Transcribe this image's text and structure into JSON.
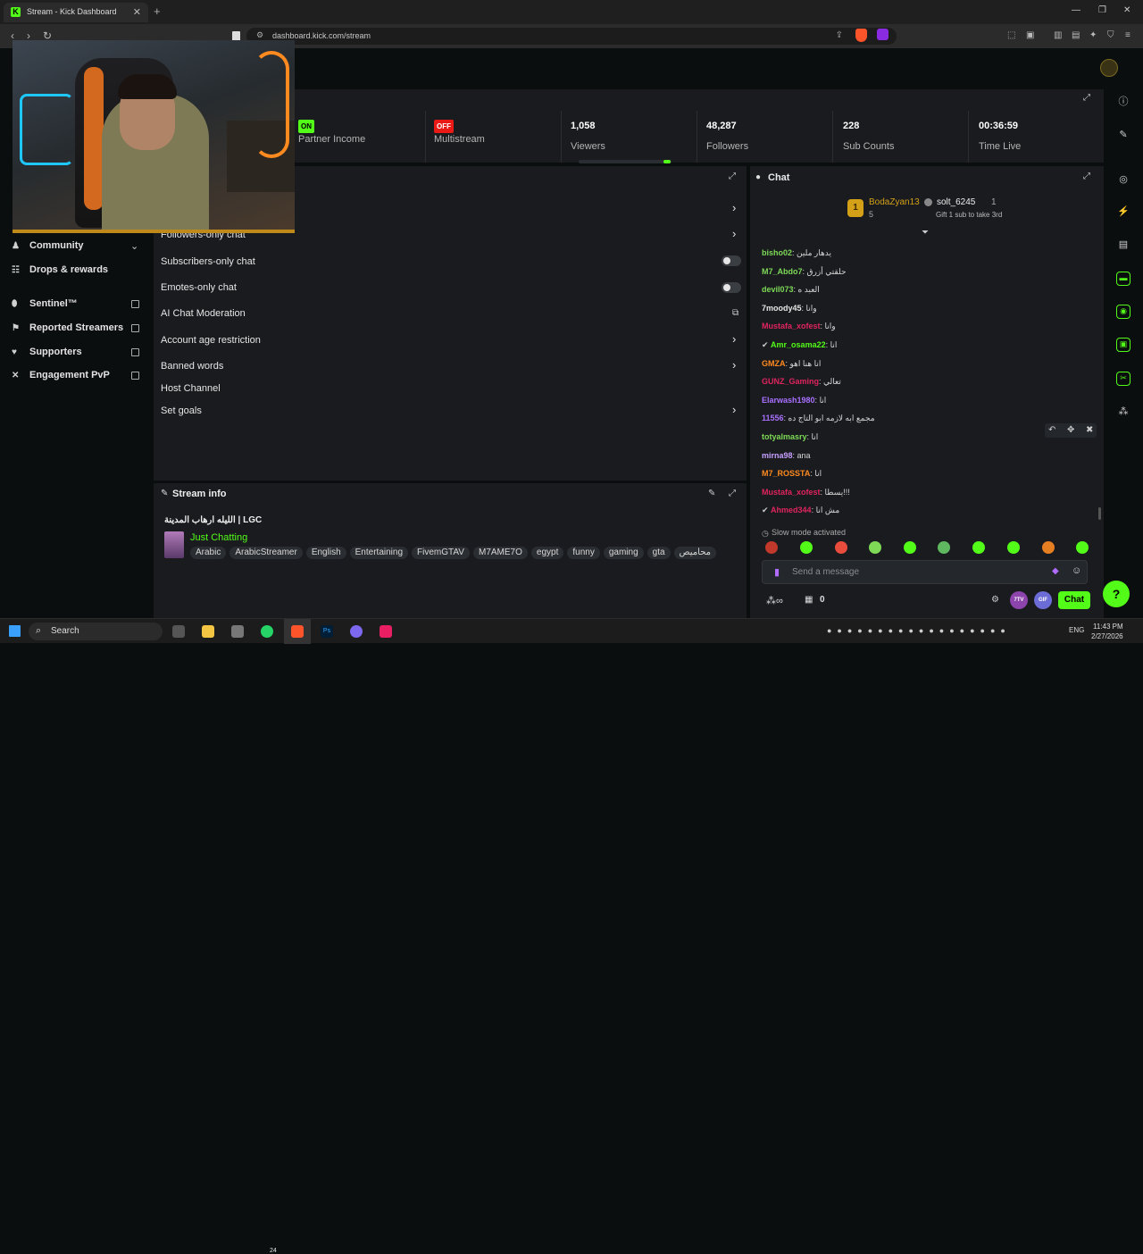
{
  "browser": {
    "tab_title": "Stream - Kick Dashboard",
    "tab_favicon": "K",
    "url": "dashboard.kick.com/stream"
  },
  "nav": {
    "items": [
      {
        "label": "Community",
        "icon": "users-icon"
      },
      {
        "label": "Drops & rewards",
        "icon": "gift-icon"
      },
      {
        "label": "Sentinel™",
        "icon": "shield-icon"
      },
      {
        "label": "Reported Streamers",
        "icon": "flag-icon"
      },
      {
        "label": "Supporters",
        "icon": "heart-icon"
      },
      {
        "label": "Engagement PvP",
        "icon": "swords-icon"
      }
    ]
  },
  "stats": {
    "partner_income": {
      "status": "ON",
      "label": "Partner Income"
    },
    "multistream": {
      "status": "OFF",
      "label": "Multistream"
    },
    "viewers": {
      "value": "1,058",
      "label": "Viewers"
    },
    "followers": {
      "value": "48,287",
      "label": "Followers"
    },
    "subs": {
      "value": "228",
      "label": "Sub Counts"
    },
    "time_live": {
      "value": "00:36:59",
      "label": "Time Live"
    }
  },
  "mod": {
    "rows": [
      {
        "label": "Followers-only chat"
      },
      {
        "label": "Subscribers-only chat"
      },
      {
        "label": "Emotes-only chat"
      },
      {
        "label": "AI Chat Moderation"
      },
      {
        "label": "Account age restriction"
      },
      {
        "label": "Banned words"
      },
      {
        "label": "Host Channel"
      },
      {
        "label": "Set goals"
      }
    ]
  },
  "stream_info": {
    "header": "Stream info",
    "title": "الليله ارهاب المدينة | LGC",
    "category": "Just Chatting",
    "tags": [
      "Arabic",
      "ArabicStreamer",
      "English",
      "Entertaining",
      "FivemGTAV",
      "M7AME7O",
      "egypt",
      "funny",
      "gaming",
      "gta",
      "محاميص"
    ]
  },
  "chat": {
    "header": "Chat",
    "leader1": {
      "name": "BodaZyan13",
      "rank": "1",
      "count": "5"
    },
    "leader2": {
      "name": "solt_6245",
      "count": "1",
      "sub": "Gift 1 sub to take 3rd"
    },
    "messages": [
      {
        "user": "bisho02",
        "text": "يدهار ملين",
        "color": "#7ed957"
      },
      {
        "user": "M7_Abdo7",
        "text": "حلقتي أزرق",
        "color": "#7ed957"
      },
      {
        "user": "devil073",
        "text": "العبد ه",
        "color": "#7ed957"
      },
      {
        "user": "7moody45",
        "text": "وانا",
        "color": "#e6e6e6"
      },
      {
        "user": "Mustafa_xofest",
        "text": "وانا",
        "color": "#e0245e"
      },
      {
        "user": "Amr_osama22",
        "text": "انا",
        "color": "#53fc18"
      },
      {
        "user": "GMZA",
        "text": "انا هنا اهو",
        "color": "#ff8a1f"
      },
      {
        "user": "GUNZ_Gaming",
        "text": "تعالي",
        "color": "#e0245e"
      },
      {
        "user": "Elarwash1980",
        "text": "انا",
        "color": "#a970ff"
      },
      {
        "user": "11556",
        "text": "مجمع ابه لازمه ابو التاج ده",
        "color": "#a970ff"
      },
      {
        "user": "totyalmasry",
        "text": "انا",
        "color": "#7ed957"
      },
      {
        "user": "mirna98",
        "text": "ana",
        "color": "#c7a0ff"
      },
      {
        "user": "M7_ROSSTA",
        "text": "انا",
        "color": "#ff8a1f"
      },
      {
        "user": "Mustafa_xofest",
        "text": "يسطا!!!",
        "color": "#e0245e"
      },
      {
        "user": "Ahmed344",
        "text": "مش انا",
        "color": "#e0245e"
      }
    ],
    "slow_mode": "Slow mode activated",
    "placeholder": "Send a message",
    "points": "0",
    "chat_button": "Chat",
    "seventv": "7TV",
    "gif": "GIF"
  },
  "taskbar": {
    "search": "Search",
    "clock": "11:43 PM",
    "date": "2/27/2026",
    "lang": "ENG",
    "badge": "24"
  },
  "colors": {
    "accent": "#53fc18",
    "danger": "#e91916",
    "panel": "#191b1f"
  }
}
